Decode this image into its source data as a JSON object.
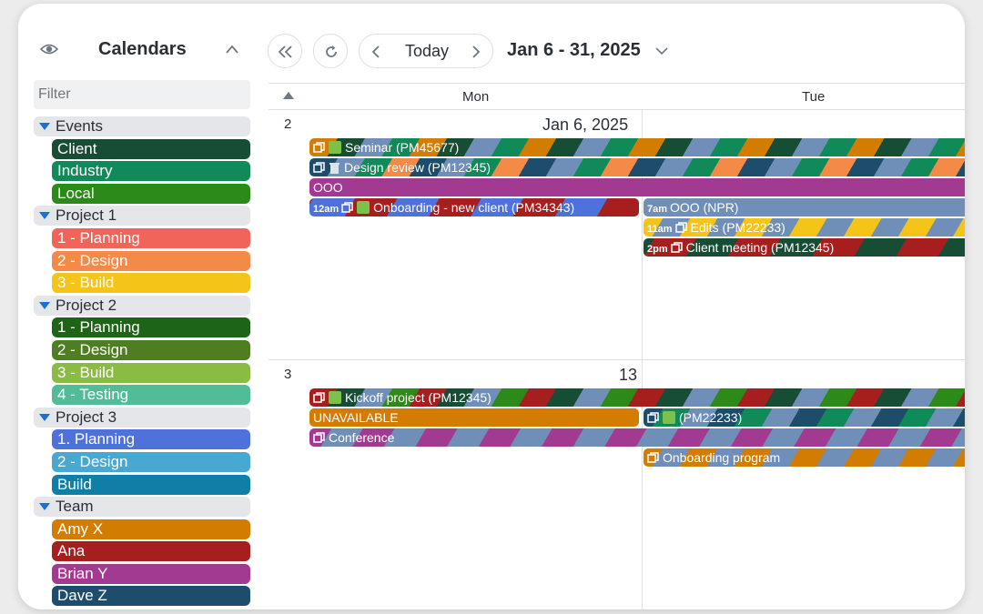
{
  "sidebar": {
    "title": "Calendars",
    "filter_placeholder": "Filter",
    "groups": [
      {
        "label": "Events",
        "items": [
          {
            "label": "Client",
            "color": "#184d35"
          },
          {
            "label": "Industry",
            "color": "#118a5a"
          },
          {
            "label": "Local",
            "color": "#2c8a18"
          }
        ]
      },
      {
        "label": "Project 1",
        "items": [
          {
            "label": "1 - Planning",
            "color": "#f0645a"
          },
          {
            "label": "2 - Design",
            "color": "#f38a48"
          },
          {
            "label": "3 - Build",
            "color": "#f4c418"
          }
        ]
      },
      {
        "label": "Project 2",
        "items": [
          {
            "label": "1 - Planning",
            "color": "#1e6418"
          },
          {
            "label": "2 - Design",
            "color": "#4f7e22"
          },
          {
            "label": "3 - Build",
            "color": "#8abc44"
          },
          {
            "label": "4 - Testing",
            "color": "#52bc98"
          }
        ]
      },
      {
        "label": "Project 3",
        "items": [
          {
            "label": "1. Planning",
            "color": "#4f71dc"
          },
          {
            "label": "2 - Design",
            "color": "#47a8d2"
          },
          {
            "label": "Build",
            "color": "#0f7fa8"
          }
        ]
      },
      {
        "label": "Team",
        "items": [
          {
            "label": "Amy X",
            "color": "#d27c00"
          },
          {
            "label": "Ana",
            "color": "#a61e1e"
          },
          {
            "label": "Brian Y",
            "color": "#a33a92"
          },
          {
            "label": "Dave Z",
            "color": "#1d4d6a"
          }
        ]
      }
    ]
  },
  "toolbar": {
    "today_label": "Today",
    "date_range": "Jan 6 - 31, 2025"
  },
  "calendar": {
    "days": [
      "Mon",
      "Tue"
    ],
    "weeks": [
      {
        "week_number": "2",
        "mon_date": "Jan 6, 2025"
      },
      {
        "week_number": "3",
        "mon_date": "13"
      }
    ],
    "events": {
      "seminar": {
        "label": "Seminar (PM45677)"
      },
      "design_review": {
        "label": "Design review (PM12345)"
      },
      "ooo": {
        "label": "OOO"
      },
      "onboarding_new": {
        "time": "12am",
        "label": "Onboarding - new client (PM34343)"
      },
      "ooo_npr": {
        "time": "7am",
        "label": "OOO (NPR)"
      },
      "edits": {
        "time": "11am",
        "label": "Edits (PM22233)"
      },
      "client_meeting": {
        "time": "2pm",
        "label": "Client meeting (PM12345)"
      },
      "kickoff": {
        "label": "Kickoff project (PM12345)"
      },
      "unavailable": {
        "label": "UNAVAILABLE"
      },
      "pm22233": {
        "label": "(PM22233)"
      },
      "conference": {
        "label": "Conference"
      },
      "onboarding_program": {
        "label": "Onboarding program"
      }
    }
  }
}
